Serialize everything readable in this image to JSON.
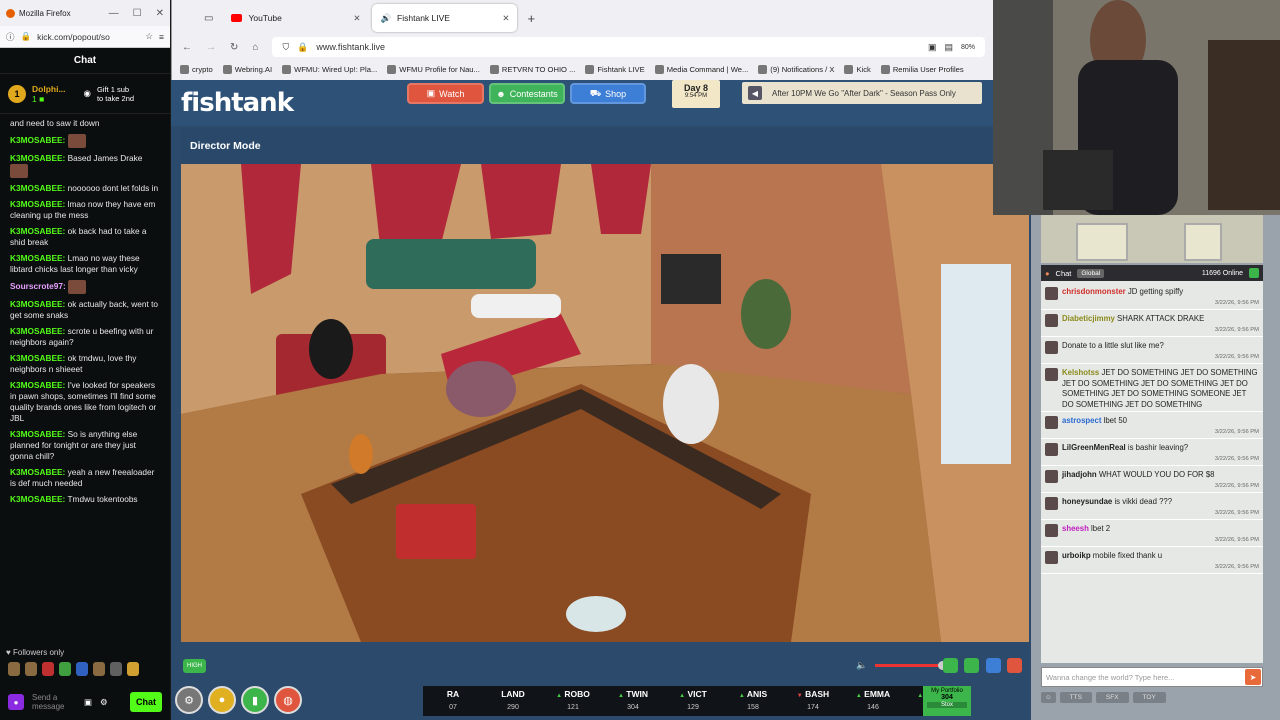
{
  "kick": {
    "window_title": "Mozilla Firefox",
    "url": "kick.com/popout/so",
    "chat_header": "Chat",
    "gift_user": "Dolphi...",
    "gift_rank": "1",
    "gift_line1": "Gift 1 sub",
    "gift_line2": "to take 2nd",
    "messages": [
      {
        "user": "",
        "text": "and need to saw it down"
      },
      {
        "user": "K3MOSABEE:",
        "text": ""
      },
      {
        "user": "K3MOSABEE:",
        "text": "Based James Drake"
      },
      {
        "user": "K3MOSABEE:",
        "text": "noooooo dont let folds in"
      },
      {
        "user": "K3MOSABEE:",
        "text": "lmao now they have em cleaning up the mess"
      },
      {
        "user": "K3MOSABEE:",
        "text": "ok back had to take a shid break"
      },
      {
        "user": "K3MOSABEE:",
        "text": "Lmao no way these libtard chicks last longer than vicky"
      },
      {
        "user": "Sourscrote97:",
        "text": ""
      },
      {
        "user": "K3MOSABEE:",
        "text": "ok actually back, went to get some snaks"
      },
      {
        "user": "K3MOSABEE:",
        "text": "scrote u beefing with ur neighbors again?"
      },
      {
        "user": "K3MOSABEE:",
        "text": "ok tmdwu, love thy neighbors n shieeet"
      },
      {
        "user": "K3MOSABEE:",
        "text": "I've looked for speakers in pawn shops, sometimes I'll find some quality brands ones like from logitech or JBL"
      },
      {
        "user": "K3MOSABEE:",
        "text": "So is anything else planned for tonight or are they just gonna chill?"
      },
      {
        "user": "K3MOSABEE:",
        "text": "yeah a new freealoader is def much needed"
      },
      {
        "user": "K3MOSABEE:",
        "text": "Tmdwu tokentoobs"
      }
    ],
    "followers_only": "Followers only",
    "send_placeholder": "Send a message",
    "send_button": "Chat"
  },
  "browser": {
    "tabs": [
      {
        "label": "YouTube",
        "active": false
      },
      {
        "label": "Fishtank LIVE",
        "active": true
      }
    ],
    "url": "www.fishtank.live",
    "zoom": "80%",
    "bookmarks": [
      "crypto",
      "Webring.AI",
      "WFMU: Wired Up!: Pla...",
      "WFMU Profile for Nau...",
      "RETVRN TO OHIO ...",
      "Fishtank LIVE",
      "Media Command | We...",
      "(9) Notifications / X",
      "Kick",
      "Remilia User Profiles"
    ]
  },
  "fishtank": {
    "logo": "fishtank",
    "watch": "Watch",
    "contestants": "Contestants",
    "shop": "Shop",
    "day": "Day 8",
    "time": "9:54 PM",
    "ticker": "After 10PM We Go \"After Dark\" - Season Pass Only",
    "director_mode": "Director Mode",
    "quality": "HIGH",
    "stocks": [
      {
        "name": "RA",
        "dir": "",
        "val": "07"
      },
      {
        "name": "LAND",
        "dir": "",
        "val": "290"
      },
      {
        "name": "ROBO",
        "dir": "▲",
        "val": "121"
      },
      {
        "name": "TWIN",
        "dir": "▲",
        "val": "304"
      },
      {
        "name": "VICT",
        "dir": "▲",
        "val": "129"
      },
      {
        "name": "ANIS",
        "dir": "▲",
        "val": "158"
      },
      {
        "name": "BASH",
        "dir": "▼",
        "val": "174"
      },
      {
        "name": "EMMA",
        "dir": "▲",
        "val": "146"
      },
      {
        "name": "HEAL",
        "dir": "▲",
        "val": "122"
      }
    ],
    "portfolio_label": "My Portfolio",
    "portfolio_value": "304",
    "portfolio_btn": "Stox"
  },
  "fishchat": {
    "tab": "Chat",
    "scope": "Global",
    "online": "11696 Online",
    "messages": [
      {
        "user": "chrisdonmonster",
        "text": "JD getting spiffy",
        "time": "3/22/26, 9:56 PM",
        "color": "#d0302a"
      },
      {
        "user": "Diabeticjimmy",
        "text": "SHARK ATTACK DRAKE",
        "time": "3/22/26, 9:56 PM",
        "color": "#8a8a1a"
      },
      {
        "user": "",
        "text": "Donate to a little slut like me?",
        "time": "3/22/26, 9:56 PM",
        "color": "#6a3ad0"
      },
      {
        "user": "Kelshotss",
        "text": "JET DO SOMETHING JET DO SOMETHING JET DO SOMETHING JET DO SOMETHING JET DO SOMETHING JET DO SOMETHING SOMEONE JET DO SOMETHING JET DO SOMETHING",
        "time": "",
        "color": "#8a8a1a"
      },
      {
        "user": "astrospect",
        "text": "lbet 50",
        "time": "3/22/26, 9:56 PM",
        "color": "#2a6ad0"
      },
      {
        "user": "LilGreenMenReal",
        "text": "is bashir leaving?",
        "time": "3/22/26, 9:56 PM",
        "color": "#222"
      },
      {
        "user": "jihadjohn",
        "text": "WHAT WOULD YOU DO FOR $8",
        "time": "3/22/26, 9:56 PM",
        "color": "#222"
      },
      {
        "user": "honeysundae",
        "text": "is vikki dead ???",
        "time": "3/22/26, 9:56 PM",
        "color": "#222"
      },
      {
        "user": "sheesh",
        "text": "lbet 2",
        "time": "3/22/26, 9:56 PM",
        "color": "#c020c0"
      },
      {
        "user": "urboikp",
        "text": "mobile fixed thank u",
        "time": "3/22/26, 9:56 PM",
        "color": "#222"
      }
    ],
    "input_placeholder": "Wanna change the world? Type here...",
    "tools": [
      "TTS",
      "SFX",
      "TOY"
    ]
  }
}
